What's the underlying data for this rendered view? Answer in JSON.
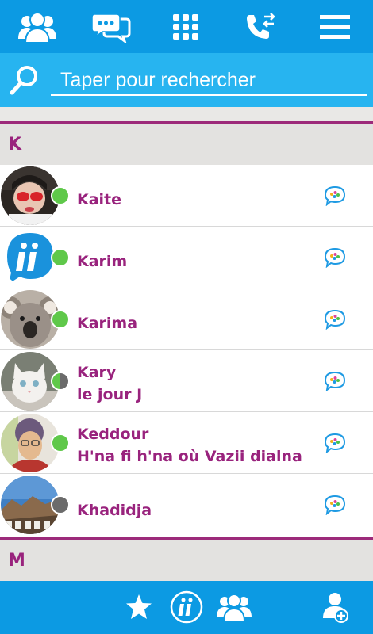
{
  "top_nav": {
    "icons": [
      "contacts-icon",
      "chat-bubbles-icon",
      "dialpad-icon",
      "call-log-icon",
      "menu-icon"
    ]
  },
  "search": {
    "placeholder": "Taper pour rechercher"
  },
  "sections": [
    {
      "letter": "K",
      "contacts": [
        {
          "name": "Kaite",
          "status": "",
          "presence": "online"
        },
        {
          "name": "Karim",
          "status": "",
          "presence": "online"
        },
        {
          "name": "Karima",
          "status": "",
          "presence": "online"
        },
        {
          "name": "Kary",
          "status": "le jour J",
          "presence": "partial"
        },
        {
          "name": "Keddour",
          "status": "H'na fi h'na où Vazii dialna",
          "presence": "online"
        },
        {
          "name": "Khadidja",
          "status": "",
          "presence": "offline"
        }
      ]
    },
    {
      "letter": "M",
      "contacts": []
    }
  ],
  "bottom_nav": {
    "icons": [
      "star-icon",
      "app-logo-icon",
      "group-icon",
      "add-contact-icon"
    ]
  },
  "colors": {
    "primary_blue": "#0c9ae3",
    "search_blue": "#27b4f0",
    "accent_purple": "#99237d",
    "online_green": "#5fc84a",
    "offline_gray": "#6b6b6b"
  }
}
